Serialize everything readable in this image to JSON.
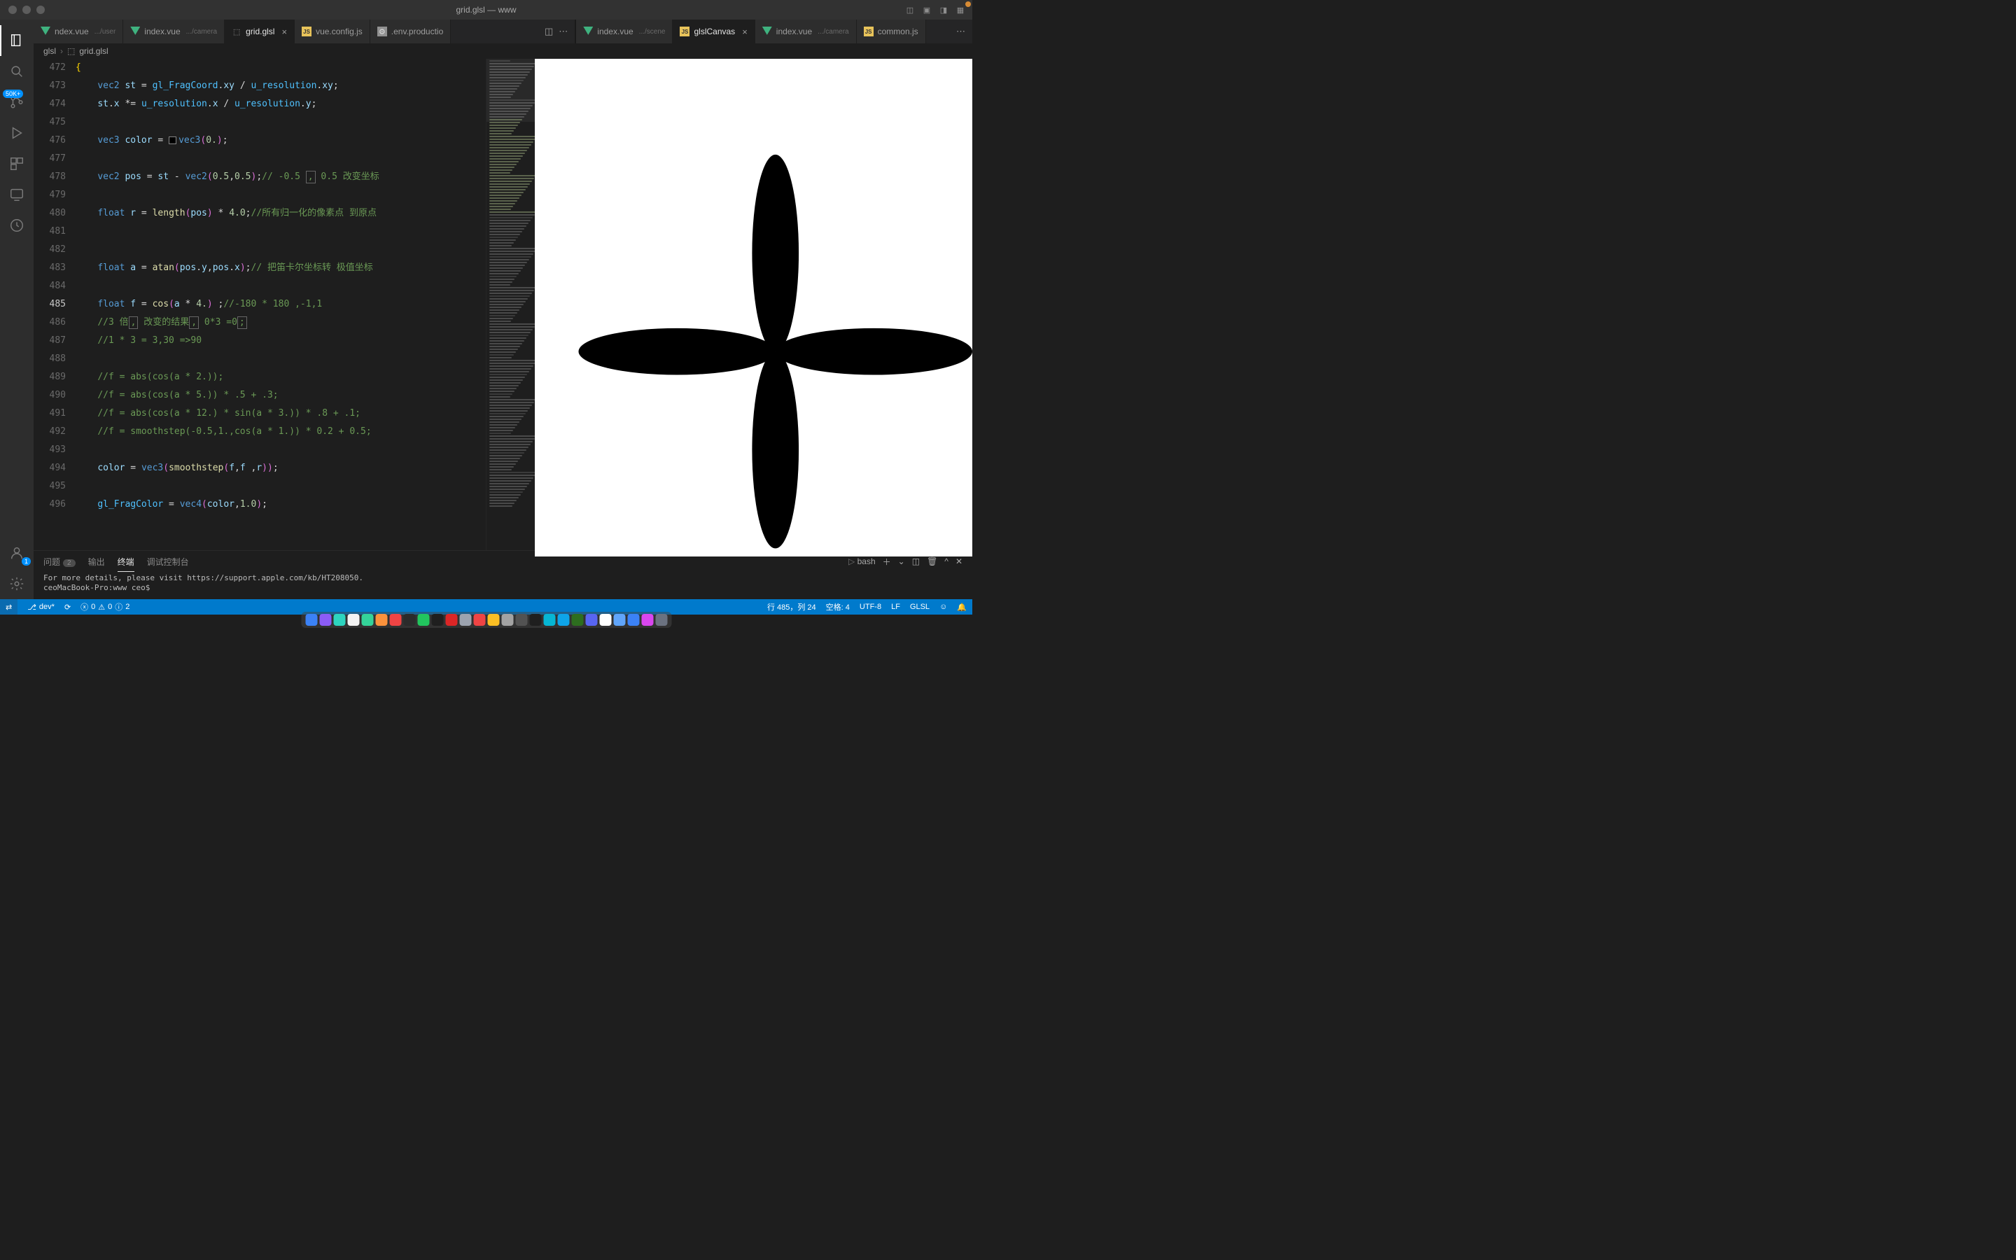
{
  "window": {
    "title": "grid.glsl — www"
  },
  "activity_badges": {
    "scm": "50K+",
    "account": "1"
  },
  "tabs_left": [
    {
      "label": "ndex.vue",
      "dim": ".../user",
      "icon": "vue",
      "active": false,
      "truncated": true
    },
    {
      "label": "index.vue",
      "dim": ".../camera",
      "icon": "vue",
      "active": false
    },
    {
      "label": "grid.glsl",
      "dim": "",
      "icon": "cube",
      "active": true,
      "closeable": true
    },
    {
      "label": "vue.config.js",
      "dim": "",
      "icon": "js",
      "active": false
    },
    {
      "label": ".env.production",
      "dim": "",
      "icon": "env",
      "active": false,
      "display": ".env.productio"
    }
  ],
  "tabs_right": [
    {
      "label": "index.vue",
      "dim": ".../scene",
      "icon": "vue",
      "active": false
    },
    {
      "label": "glslCanvas",
      "dim": "",
      "icon": "js",
      "active": true,
      "closeable": true
    },
    {
      "label": "index.vue",
      "dim": ".../camera",
      "icon": "vue",
      "active": false
    },
    {
      "label": "common.js",
      "dim": "",
      "icon": "js",
      "active": false
    }
  ],
  "breadcrumb": [
    "glsl",
    "grid.glsl"
  ],
  "gutter": {
    "start": 472,
    "end": 496,
    "current": 485
  },
  "code": {
    "472": "{",
    "473": "    vec2 st = gl_FragCoord.xy / u_resolution.xy;",
    "474": "    st.x *= u_resolution.x / u_resolution.y;",
    "475": "",
    "476": "    vec3 color = vec3(0.);",
    "477": "",
    "478": "    vec2 pos = st - vec2(0.5,0.5);// -0.5 , 0.5 改变坐标",
    "479": "",
    "480": "    float r = length(pos) * 4.0;//所有归一化的像素点 到原点",
    "481": "",
    "482": "",
    "483": "    float a = atan(pos.y,pos.x);// 把笛卡尔坐标转 极值坐标",
    "484": "",
    "485": "    float f = cos(a * 4.) ;//-180 * 180 ,-1,1",
    "486": "    //3 倍, 改变的结果, 0*3 =0;",
    "487": "    //1 * 3 = 3,30 =>90",
    "488": "",
    "489": "    //f = abs(cos(a * 2.));",
    "490": "    //f = abs(cos(a * 5.)) * .5 + .3;",
    "491": "    //f = abs(cos(a * 12.) * sin(a * 3.)) * .8 + .1;",
    "492": "    //f = smoothstep(-0.5,1.,cos(a * 1.)) * 0.2 + 0.5;",
    "493": "",
    "494": "    color = vec3(smoothstep(f,f ,r));",
    "495": "",
    "496": "    gl_FragColor = vec4(color,1.0);"
  },
  "terminal": {
    "tabs": [
      {
        "label": "问题",
        "badge": "2"
      },
      {
        "label": "输出"
      },
      {
        "label": "终端",
        "active": true
      },
      {
        "label": "调试控制台"
      }
    ],
    "shell": "bash",
    "lines": [
      "For more details, please visit https://support.apple.com/kb/HT208050.",
      "ceoMacBook-Pro:www ceo$"
    ]
  },
  "status": {
    "branch": "dev*",
    "errors": "0",
    "warnings": "0",
    "info": "2",
    "cursor": "行 485，列 24",
    "spaces": "空格: 4",
    "encoding": "UTF-8",
    "eol": "LF",
    "lang": "GLSL"
  },
  "dock_colors": [
    "#3b82f6",
    "#8b5cf6",
    "#2dd4bf",
    "#f3f3f3",
    "#34d399",
    "#fb923c",
    "#ef4444",
    "#2b2b2b",
    "#22c55e",
    "#1f1f1f",
    "#dc2626",
    "#9ca3af",
    "#ef4444",
    "#fbbf24",
    "#a3a3a3",
    "#525252",
    "#1f1f1f",
    "#06b6d4",
    "#0ea5e9",
    "#2d6e1f",
    "#5865f2",
    "#ffffff",
    "#60a5fa",
    "#3b82f6",
    "#d946ef",
    "#6b7280"
  ]
}
